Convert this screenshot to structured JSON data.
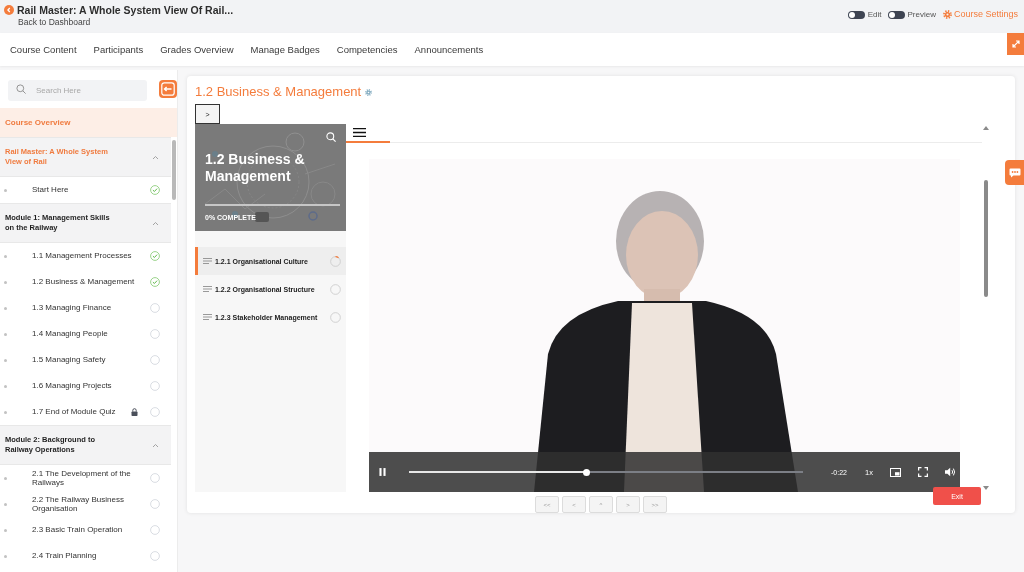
{
  "header": {
    "title": "Rail Master: A Whole System View Of Rail...",
    "back_link": "Back to Dashboard",
    "toggles": [
      {
        "label": "Edit",
        "on": false
      },
      {
        "label": "Preview",
        "on": false
      }
    ],
    "settings_link": "Course Settings"
  },
  "tabs": [
    {
      "label": "Course Content",
      "selected": false
    },
    {
      "label": "Participants",
      "selected": false
    },
    {
      "label": "Grades Overview",
      "selected": false
    },
    {
      "label": "Manage Badges",
      "selected": false
    },
    {
      "label": "Competencies",
      "selected": false
    },
    {
      "label": "Announcements",
      "selected": false
    }
  ],
  "sidebar": {
    "search": {
      "placeholder": "Search Here"
    },
    "overview": "Course Overview",
    "sections": [
      {
        "title": "Rail Master: A Whole System View of Rail",
        "active": true,
        "expanded": true,
        "items": [
          {
            "label": "Start Here",
            "completed": true,
            "locked": false
          }
        ]
      },
      {
        "title": "Module 1: Management Skills on the Railway",
        "active": false,
        "expanded": true,
        "items": [
          {
            "label": "1.1 Management Processes",
            "completed": true,
            "locked": false
          },
          {
            "label": "1.2 Business & Management",
            "completed": true,
            "locked": false
          },
          {
            "label": "1.3 Managing Finance",
            "completed": false,
            "locked": false
          },
          {
            "label": "1.4 Managing People",
            "completed": false,
            "locked": false
          },
          {
            "label": "1.5 Managing Safety",
            "completed": false,
            "locked": false
          },
          {
            "label": "1.6 Managing Projects",
            "completed": false,
            "locked": false
          },
          {
            "label": "1.7 End of Module Quiz",
            "completed": false,
            "locked": true
          }
        ]
      },
      {
        "title": "Module 2: Background to Railway Operations",
        "active": false,
        "expanded": true,
        "items": [
          {
            "label": "2.1 The Development of the Railways",
            "completed": false,
            "locked": false
          },
          {
            "label": "2.2 The Railway Business Organisation",
            "completed": false,
            "locked": false
          },
          {
            "label": "2.3 Basic Train Operation",
            "completed": false,
            "locked": false
          },
          {
            "label": "2.4 Train Planning",
            "completed": false,
            "locked": false
          }
        ]
      }
    ]
  },
  "lesson": {
    "title": "1.2 Business & Management",
    "panel_toggle": ">",
    "player": {
      "cover": {
        "title": "1.2 Business & Management",
        "progress_label": "0% COMPLETE"
      },
      "topics": [
        {
          "label": "1.2.1 Organisational Culture",
          "selected": true,
          "in_progress": true
        },
        {
          "label": "1.2.2 Organisational Structure",
          "selected": false,
          "in_progress": false
        },
        {
          "label": "1.2.3 Stakeholder Management",
          "selected": false,
          "in_progress": false
        }
      ],
      "video": {
        "playing": true,
        "level": 0.45,
        "time": "-0:22",
        "speed": "1x"
      }
    },
    "exit_button": "Exit",
    "pager": [
      {
        "label": "<<"
      },
      {
        "label": "<"
      },
      {
        "label": "^"
      },
      {
        "label": ">"
      },
      {
        "label": ">>"
      }
    ]
  }
}
